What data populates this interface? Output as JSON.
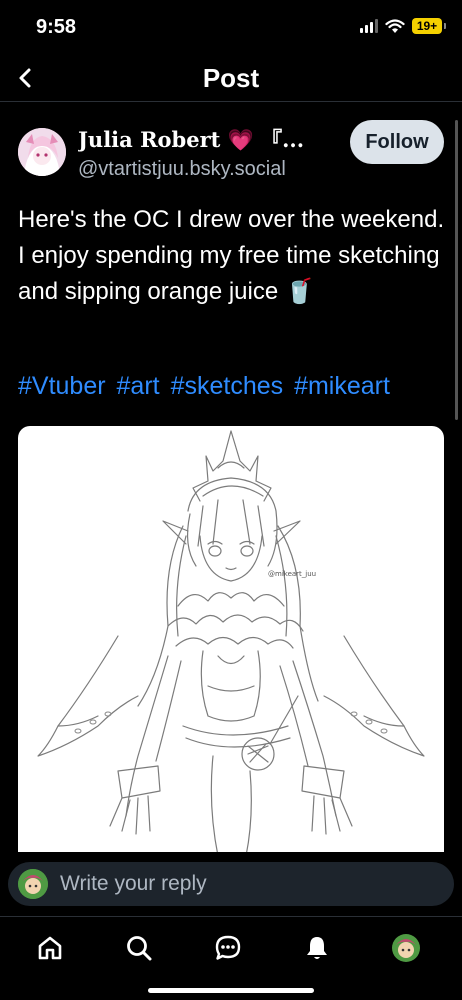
{
  "status_bar": {
    "time": "9:58",
    "battery": "19+"
  },
  "header": {
    "title": "Post"
  },
  "post": {
    "author_name": "Julia Robert 💗 『...",
    "handle": "@vtartistjuu.bsky.social",
    "follow_label": "Follow",
    "text": "Here's the OC I drew over the weekend. I enjoy spending my free time sketching and sipping orange juice 🥤",
    "hashtags": [
      "#Vtuber",
      "#art",
      "#sketches",
      "#mikeart"
    ],
    "image_signature": "@mikeart_juu"
  },
  "reply": {
    "placeholder": "Write your reply"
  },
  "tab_bar": {
    "items": [
      "home-icon",
      "search-icon",
      "chat-icon",
      "notifications-icon",
      "profile-avatar"
    ]
  },
  "colors": {
    "background": "#000000",
    "accent": "#2f8cff",
    "follow_bg": "#dce3ea",
    "battery": "#f5d100"
  }
}
